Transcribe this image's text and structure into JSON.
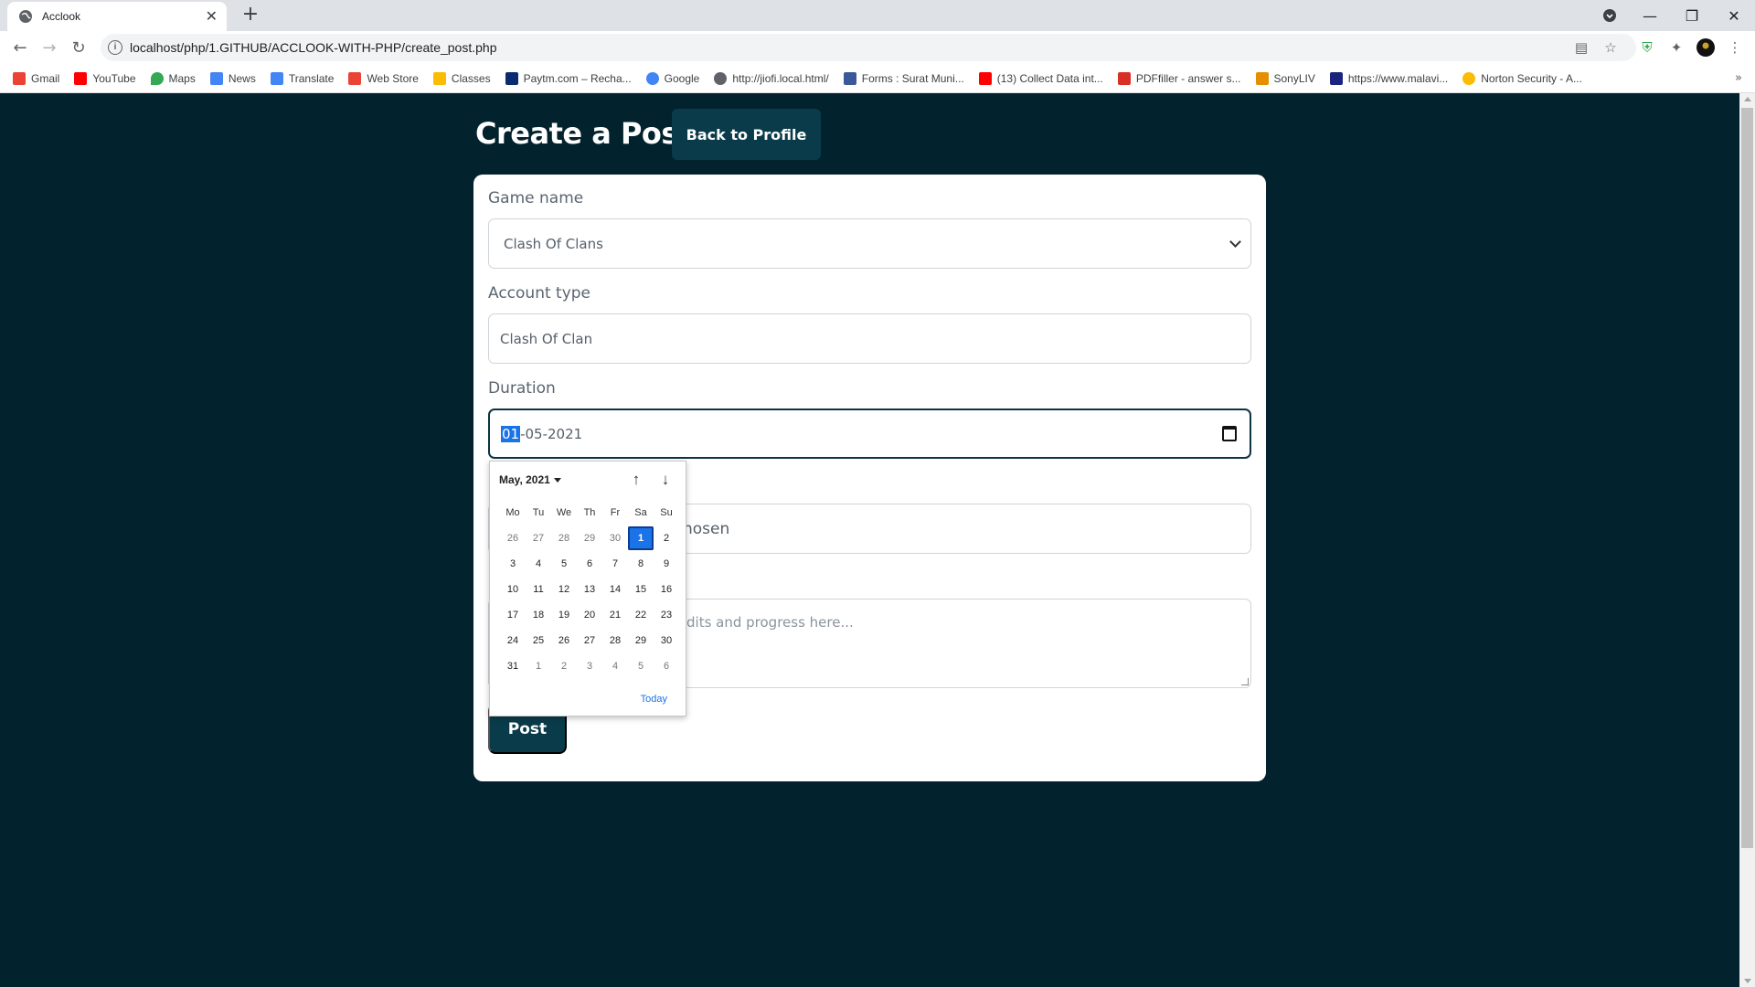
{
  "browser": {
    "tab_title": "Acclook",
    "url": "localhost/php/1.GITHUB/ACCLOOK-WITH-PHP/create_post.php",
    "bookmarks": [
      {
        "label": "Gmail",
        "color": "#ea4335"
      },
      {
        "label": "YouTube",
        "color": "#ff0000"
      },
      {
        "label": "Maps",
        "color": "#34a853"
      },
      {
        "label": "News",
        "color": "#4285f4"
      },
      {
        "label": "Translate",
        "color": "#4285f4"
      },
      {
        "label": "Web Store",
        "color": "#ea4335"
      },
      {
        "label": "Classes",
        "color": "#fbbc04"
      },
      {
        "label": "Paytm.com – Recha...",
        "color": "#0b2a6f"
      },
      {
        "label": "Google",
        "color": "#4285f4"
      },
      {
        "label": "http://jiofi.local.html/",
        "color": "#5f6368"
      },
      {
        "label": "Forms : Surat Muni...",
        "color": "#3b5998"
      },
      {
        "label": "(13) Collect Data int...",
        "color": "#ff0000"
      },
      {
        "label": "PDFfiller - answer s...",
        "color": "#d93025"
      },
      {
        "label": "SonyLIV",
        "color": "#e58e00"
      },
      {
        "label": "https://www.malavi...",
        "color": "#1a237e"
      },
      {
        "label": "Norton Security - A...",
        "color": "#fbbc04"
      }
    ]
  },
  "page": {
    "heading": "Create a Post",
    "back_button": "Back to Profile",
    "game_name_label": "Game name",
    "game_name_value": "Clash Of Clans",
    "account_type_label": "Account type",
    "account_type_value": "Clash Of Clan",
    "duration_label": "Duration",
    "duration_day": "01",
    "duration_rest": "-05-2021",
    "file_text_visible": "hosen",
    "description_placeholder_visible": "dits and progress here...",
    "post_button": "Post"
  },
  "datepicker": {
    "month_label": "May, 2021",
    "weekdays": [
      "Mo",
      "Tu",
      "We",
      "Th",
      "Fr",
      "Sa",
      "Su"
    ],
    "weeks": [
      [
        "26",
        "27",
        "28",
        "29",
        "30",
        "1",
        "2"
      ],
      [
        "3",
        "4",
        "5",
        "6",
        "7",
        "8",
        "9"
      ],
      [
        "10",
        "11",
        "12",
        "13",
        "14",
        "15",
        "16"
      ],
      [
        "17",
        "18",
        "19",
        "20",
        "21",
        "22",
        "23"
      ],
      [
        "24",
        "25",
        "26",
        "27",
        "28",
        "29",
        "30"
      ],
      [
        "31",
        "1",
        "2",
        "3",
        "4",
        "5",
        "6"
      ]
    ],
    "selected": "1",
    "today_label": "Today"
  }
}
